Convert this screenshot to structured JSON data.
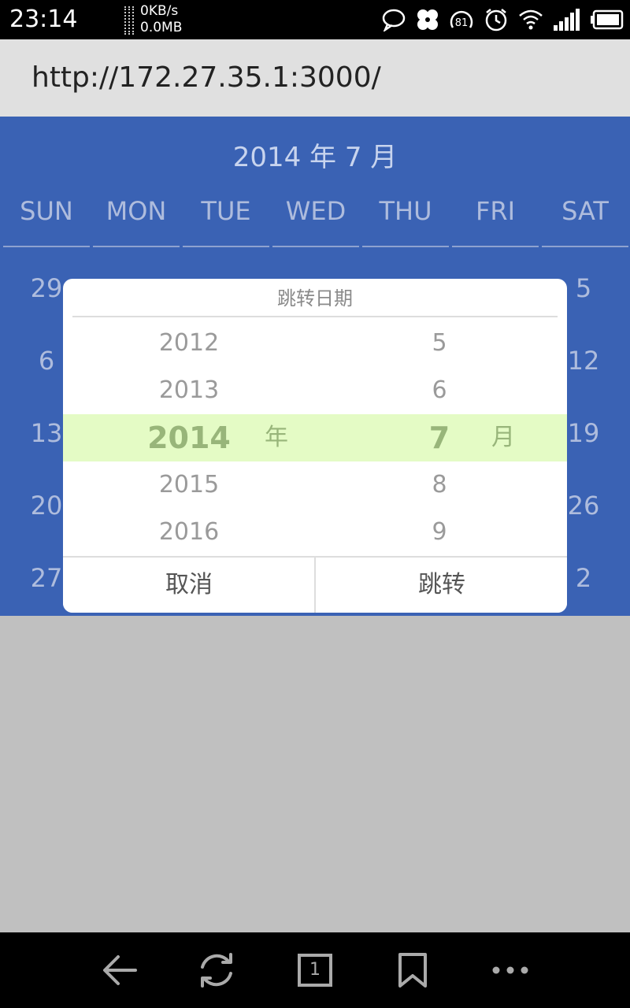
{
  "status_bar": {
    "time": "23:14",
    "net_speed": "0KB/s",
    "net_data": "0.0MB",
    "battery_level_text": "81",
    "icons": [
      "speech-bubble-icon",
      "pinwheel-icon",
      "speed-81-icon",
      "alarm-clock-icon",
      "wifi-icon",
      "signal-icon",
      "battery-icon"
    ]
  },
  "browser": {
    "url": "http://172.27.35.1:3000/"
  },
  "calendar": {
    "title": "2014 年 7 月",
    "weekdays": [
      "SUN",
      "MON",
      "TUE",
      "WED",
      "THU",
      "FRI",
      "SAT"
    ],
    "visible_days": {
      "sun": [
        "29",
        "6",
        "13",
        "20",
        "27"
      ],
      "sat": [
        "5",
        "12",
        "19",
        "26",
        "2"
      ]
    }
  },
  "dialog": {
    "title": "跳转日期",
    "years": [
      "2012",
      "2013",
      "2014",
      "2015",
      "2016"
    ],
    "months": [
      "5",
      "6",
      "7",
      "8",
      "9"
    ],
    "selected_year": "2014",
    "selected_month": "7",
    "year_unit": "年",
    "month_unit": "月",
    "cancel_label": "取消",
    "confirm_label": "跳转"
  },
  "bottom_nav": {
    "tab_count": "1",
    "icons": [
      "back-arrow-icon",
      "refresh-icon",
      "tabs-icon",
      "bookmark-icon",
      "more-icon"
    ]
  },
  "colors": {
    "calendar_bg": "#3a62b4",
    "highlight_bg": "#e4fbc5",
    "highlight_text": "#98b57a",
    "overlay_bg": "#c0c0c0"
  }
}
